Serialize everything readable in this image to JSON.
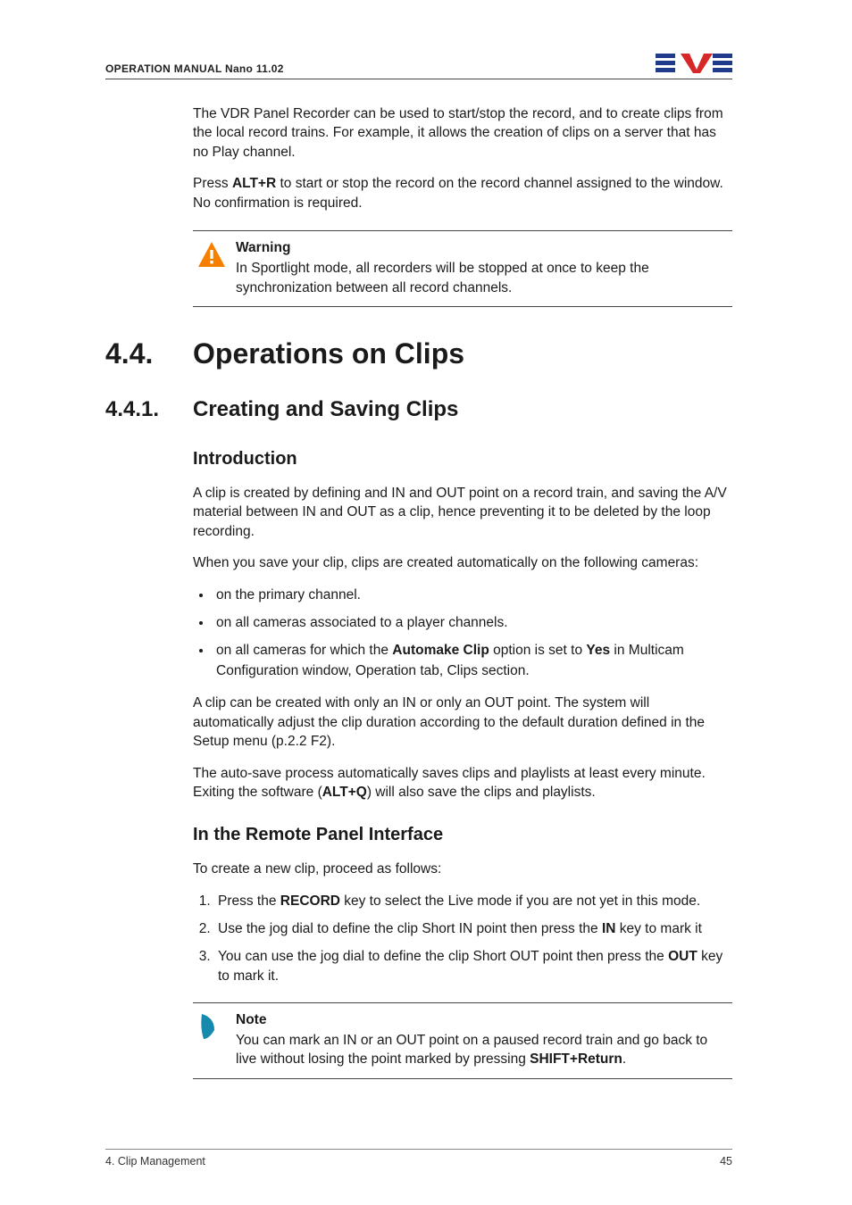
{
  "header": {
    "left": "OPERATION MANUAL Nano 11.02"
  },
  "intro": {
    "p1_a": "The VDR Panel Recorder can be used to start/stop the record, and to create clips from the local record trains. For example, it allows the creation of clips on a server that has no Play channel.",
    "p2_a": "Press ",
    "p2_b": "ALT+R",
    "p2_c": " to start or stop the record on the record channel assigned to the window. No confirmation is required."
  },
  "warning": {
    "title": "Warning",
    "body": "In Sportlight mode, all recorders will be stopped at once to keep the synchronization between all record channels."
  },
  "sec44": {
    "num": "4.4.",
    "title": "Operations on Clips"
  },
  "sec441": {
    "num": "4.4.1.",
    "title": "Creating and Saving Clips"
  },
  "intro2": {
    "h": "Introduction",
    "p1": "A clip is created by defining and IN and OUT point on a record train, and saving the A/V material between IN and OUT as a clip, hence preventing it to be deleted by the loop recording.",
    "p2": "When you save your clip, clips are created automatically on the following cameras:",
    "b1": "on the primary channel.",
    "b2": "on all cameras associated to a player channels.",
    "b3_a": "on all cameras for which the ",
    "b3_b": "Automake Clip",
    "b3_c": " option is set to ",
    "b3_d": "Yes",
    "b3_e": " in Multicam Configuration window, Operation tab, Clips section.",
    "p3": "A clip can be created with only an IN or only an OUT point. The system will automatically adjust the clip duration according to the default duration defined in the Setup menu (p.2.2 F2).",
    "p4_a": "The auto-save process automatically saves clips and playlists at least every minute. Exiting the software (",
    "p4_b": "ALT+Q",
    "p4_c": ") will also save the clips and playlists."
  },
  "remote": {
    "h": "In the Remote Panel Interface",
    "lead": "To create a new clip, proceed as follows:",
    "s1_a": "Press the ",
    "s1_b": "RECORD",
    "s1_c": " key to select the Live mode if you are not yet in this mode.",
    "s2_a": "Use the jog dial to define the clip Short IN point then press the ",
    "s2_b": "IN",
    "s2_c": " key to mark it",
    "s3_a": "You can use the jog dial to define the clip Short OUT point then press the ",
    "s3_b": "OUT",
    "s3_c": " key to mark it."
  },
  "note": {
    "title": "Note",
    "body_a": "You can mark an IN or an OUT point on a paused record train and go back to live without losing the point marked by pressing ",
    "body_b": "SHIFT+Return",
    "body_c": "."
  },
  "footer": {
    "left": "4. Clip Management",
    "right": "45"
  }
}
